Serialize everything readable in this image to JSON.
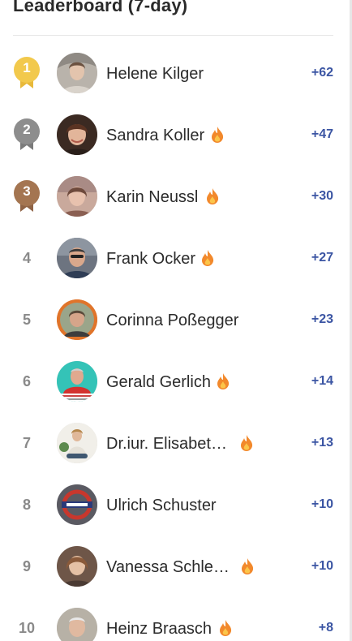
{
  "leaderboard": {
    "title": "Leaderboard (7-day)",
    "entries": [
      {
        "rank": "1",
        "name": "Helene Kilger",
        "points": "+62",
        "fire": false,
        "medal": "gold"
      },
      {
        "rank": "2",
        "name": "Sandra Koller",
        "points": "+47",
        "fire": true,
        "medal": "silver"
      },
      {
        "rank": "3",
        "name": "Karin Neussl",
        "points": "+30",
        "fire": true,
        "medal": "bronze"
      },
      {
        "rank": "4",
        "name": "Frank Ocker",
        "points": "+27",
        "fire": true,
        "medal": null
      },
      {
        "rank": "5",
        "name": "Corinna Poßegger",
        "points": "+23",
        "fire": false,
        "medal": null
      },
      {
        "rank": "6",
        "name": "Gerald Gerlich",
        "points": "+14",
        "fire": true,
        "medal": null
      },
      {
        "rank": "7",
        "name": "Dr.iur. Elisabeth…",
        "points": "+13",
        "fire": true,
        "medal": null
      },
      {
        "rank": "8",
        "name": "Ulrich Schuster",
        "points": "+10",
        "fire": false,
        "medal": null
      },
      {
        "rank": "9",
        "name": "Vanessa Schle…",
        "points": "+10",
        "fire": true,
        "medal": null
      },
      {
        "rank": "10",
        "name": "Heinz Braasch",
        "points": "+8",
        "fire": true,
        "medal": null
      }
    ]
  },
  "colors": {
    "points": "#3b55a3",
    "gold": "#f2c94c",
    "silver": "#8d8d8d",
    "bronze": "#a47551",
    "fire_outer": "#f2892c",
    "fire_inner": "#fbc54a"
  },
  "icons": {
    "streak": "fire-icon",
    "medal": "medal-icon"
  }
}
